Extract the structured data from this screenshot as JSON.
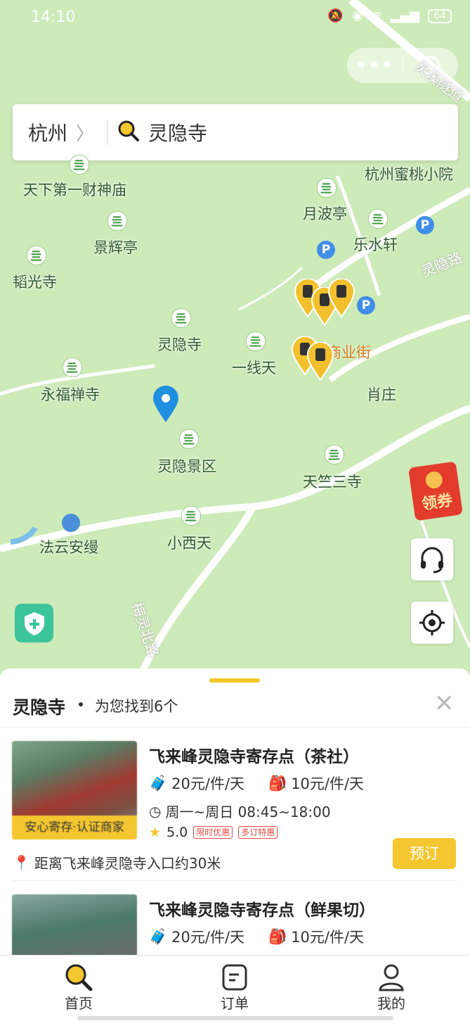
{
  "status_bar": {
    "time": "14:10",
    "battery": "64"
  },
  "search": {
    "city": "杭州",
    "query": "灵隐寺"
  },
  "map": {
    "pois": [
      "天下第一财神庙",
      "景辉亭",
      "韬光寺",
      "灵隐寺",
      "一线天",
      "永福禅寺",
      "灵隐景区",
      "小西天",
      "天竺三寺",
      "月波亭",
      "乐水轩",
      "杭州蜜桃小院",
      "肖庄"
    ],
    "hotel": "法云安缦",
    "shopping": "商业街",
    "roads": [
      "灵隐路",
      "梅灵北路",
      "灵溪隧道"
    ]
  },
  "coupon": {
    "label": "领券"
  },
  "sheet": {
    "title": "灵隐寺",
    "subtitle": "为您找到6个",
    "items": [
      {
        "name": "飞来峰灵隐寺寄存点（茶社）",
        "price_luggage": "20元/件/天",
        "price_bag": "10元/件/天",
        "hours": "周一~周日 08:45~18:00",
        "rating": "5.0",
        "tags": [
          "限时优惠",
          "多订特惠"
        ],
        "badge": "安心寄存·认证商家",
        "distance": "距离飞来峰灵隐寺入口约30米",
        "book_label": "预订"
      },
      {
        "name": "飞来峰灵隐寺寄存点（鲜果切）",
        "price_luggage": "20元/件/天",
        "price_bag": "10元/件/天"
      }
    ]
  },
  "tabs": [
    {
      "label": "首页",
      "icon": "search-icon"
    },
    {
      "label": "订单",
      "icon": "order-icon"
    },
    {
      "label": "我的",
      "icon": "user-icon"
    }
  ],
  "colors": {
    "accent": "#f4c62f",
    "map_bg": "#cdeab9",
    "pin": "#1f8fe0"
  }
}
